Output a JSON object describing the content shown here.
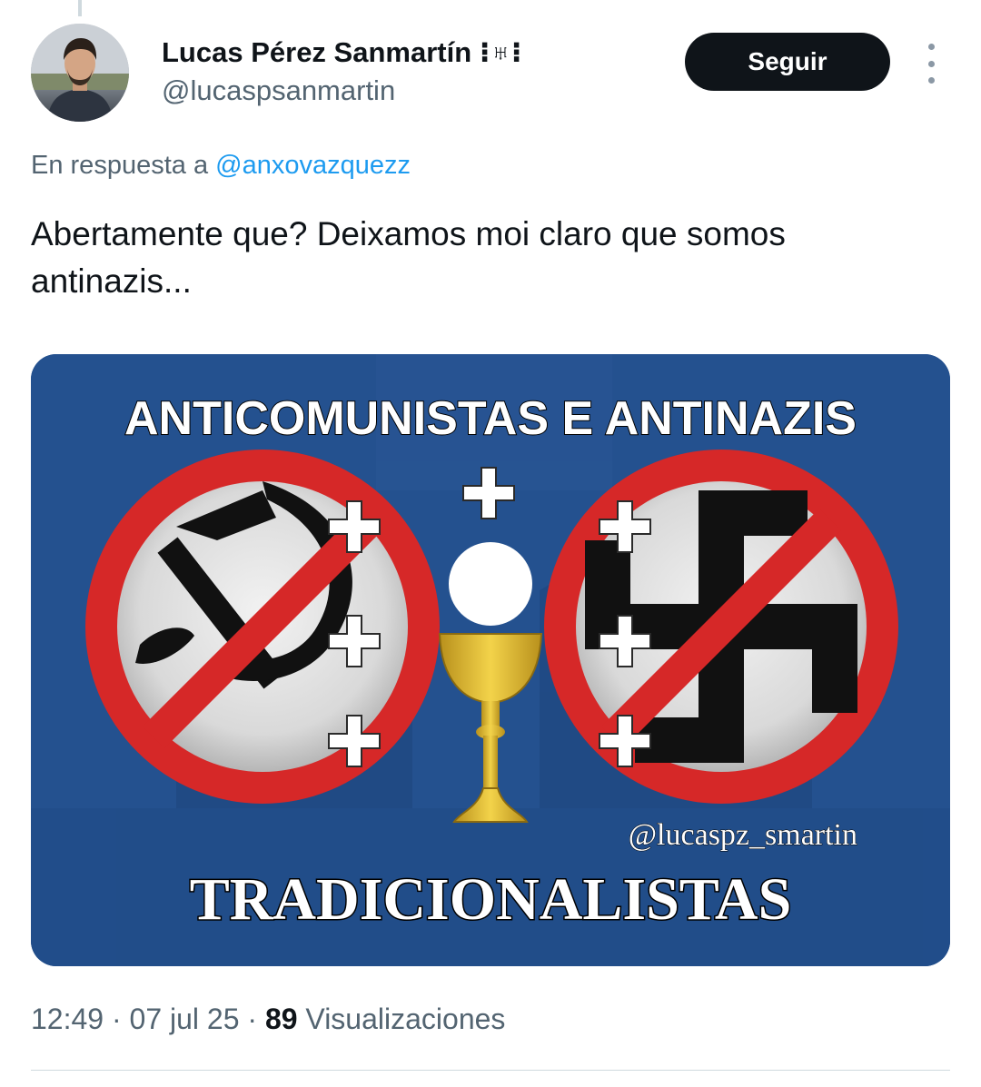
{
  "tweet": {
    "author": {
      "display_name": "Lucas Pérez Sanmartín",
      "name_emoji": "⁝♅⁝",
      "handle": "@lucaspsanmartin"
    },
    "follow_label": "Seguir",
    "reply_prefix": "En respuesta a",
    "reply_to": "@anxovazquezz",
    "text": "Abertamente que? Deixamos moi claro que somos antinazis...",
    "image": {
      "top_text": "ANTICOMUNISTAS E ANTINAZIS",
      "watermark": "@lucaspz_smartin",
      "bottom_text": "TRADICIONALISTAS"
    },
    "time": "12:49",
    "date": "07 jul 25",
    "separator": "·",
    "views_count": "89",
    "views_label": "Visualizaciones"
  },
  "colors": {
    "accent": "#1d9bf0",
    "text_secondary": "#536471",
    "button_bg": "#0f1419",
    "image_bg": "#24518f",
    "prohibition_red": "#d62828",
    "chalice_gold": "#e8c437"
  },
  "icons": [
    "more-options-icon",
    "hammer-sickle-icon",
    "swastika-icon",
    "chalice-icon",
    "host-icon",
    "cross-icon"
  ]
}
